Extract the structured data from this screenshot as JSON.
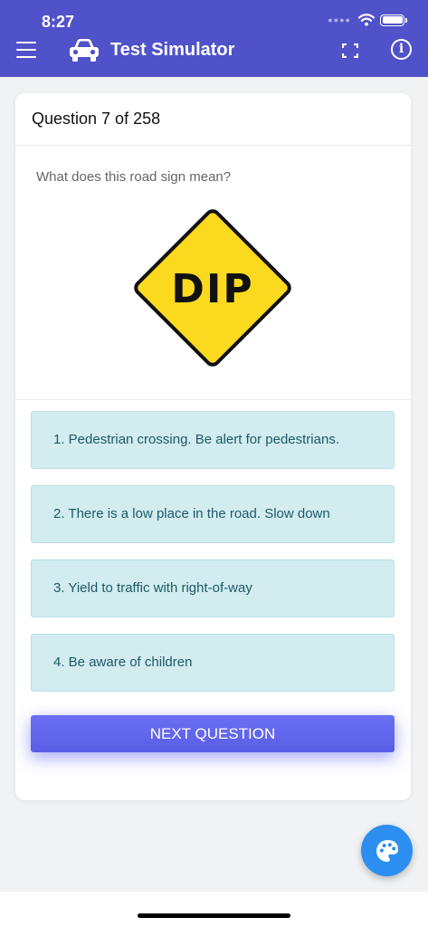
{
  "status": {
    "time": "8:27"
  },
  "appbar": {
    "title": "Test Simulator",
    "icons": [
      "menu-icon",
      "car-icon",
      "fullscreen-icon",
      "info-icon"
    ],
    "info_glyph": "i"
  },
  "quiz": {
    "header": "Question 7 of 258",
    "question": "What does this road sign mean?",
    "sign_text": "DIP",
    "answers": [
      {
        "label": "1. Pedestrian crossing. Be alert for pedestrians."
      },
      {
        "label": "2. There is a low place in the road. Slow down"
      },
      {
        "label": "3. Yield to traffic with right-of-way"
      },
      {
        "label": "4. Be aware of children"
      }
    ],
    "next_label": "NEXT QUESTION"
  },
  "fab": {
    "icon": "palette-icon"
  },
  "colors": {
    "appbar": "#4f52c9",
    "answer_bg": "#d2ecf0",
    "answer_text": "#1c5a67",
    "next_button": "#5f63ec",
    "fab": "#2c8ef0",
    "sign_yellow": "#fbd91f"
  }
}
